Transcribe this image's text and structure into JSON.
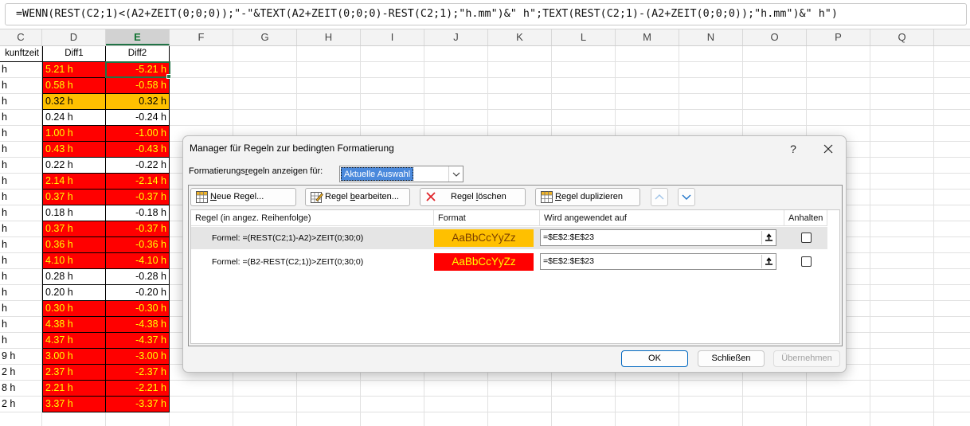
{
  "formula_bar": {
    "formula": "=WENN(REST(C2;1)<(A2+ZEIT(0;0;0));\"-\"&TEXT(A2+ZEIT(0;0;0)-REST(C2;1);\"h.mm\")&\" h\";TEXT(REST(C2;1)-(A2+ZEIT(0;0;0));\"h.mm\")&\" h\")"
  },
  "columns": [
    "C",
    "D",
    "E",
    "F",
    "G",
    "H",
    "I",
    "J",
    "K",
    "L",
    "M",
    "N",
    "O",
    "P",
    "Q"
  ],
  "table": {
    "headers": {
      "c": "kunftzeit",
      "d": "Diff1",
      "e": "Diff2"
    },
    "rows": [
      {
        "c": "h",
        "d": "5.21 h",
        "e": "-5.21 h",
        "d_fill": "red",
        "e_fill": "red"
      },
      {
        "c": "h",
        "d": "0.58 h",
        "e": "-0.58 h",
        "d_fill": "red",
        "e_fill": "red"
      },
      {
        "c": "h",
        "d": "0.32 h",
        "e": "0.32 h",
        "d_fill": "orange",
        "e_fill": "orange"
      },
      {
        "c": "h",
        "d": "0.24 h",
        "e": "-0.24 h",
        "d_fill": "none",
        "e_fill": "none"
      },
      {
        "c": "h",
        "d": "1.00 h",
        "e": "-1.00 h",
        "d_fill": "red",
        "e_fill": "red"
      },
      {
        "c": "h",
        "d": "0.43 h",
        "e": "-0.43 h",
        "d_fill": "red",
        "e_fill": "red"
      },
      {
        "c": "h",
        "d": "0.22 h",
        "e": "-0.22 h",
        "d_fill": "none",
        "e_fill": "none"
      },
      {
        "c": "h",
        "d": "2.14 h",
        "e": "-2.14 h",
        "d_fill": "red",
        "e_fill": "red"
      },
      {
        "c": "h",
        "d": "0.37 h",
        "e": "-0.37 h",
        "d_fill": "red",
        "e_fill": "red"
      },
      {
        "c": "h",
        "d": "0.18 h",
        "e": "-0.18 h",
        "d_fill": "none",
        "e_fill": "none"
      },
      {
        "c": "h",
        "d": "0.37 h",
        "e": "-0.37 h",
        "d_fill": "red",
        "e_fill": "red"
      },
      {
        "c": "h",
        "d": "0.36 h",
        "e": "-0.36 h",
        "d_fill": "red",
        "e_fill": "red"
      },
      {
        "c": "h",
        "d": "4.10 h",
        "e": "-4.10 h",
        "d_fill": "red",
        "e_fill": "red"
      },
      {
        "c": "h",
        "d": "0.28 h",
        "e": "-0.28 h",
        "d_fill": "none",
        "e_fill": "none"
      },
      {
        "c": "h",
        "d": "0.20 h",
        "e": "-0.20 h",
        "d_fill": "none",
        "e_fill": "none"
      },
      {
        "c": "h",
        "d": "0.30 h",
        "e": "-0.30 h",
        "d_fill": "red",
        "e_fill": "red"
      },
      {
        "c": "h",
        "d": "4.38 h",
        "e": "-4.38 h",
        "d_fill": "red",
        "e_fill": "red"
      },
      {
        "c": "h",
        "d": "4.37 h",
        "e": "-4.37 h",
        "d_fill": "red",
        "e_fill": "red"
      },
      {
        "c": "9 h",
        "d": "3.00 h",
        "e": "-3.00 h",
        "d_fill": "red",
        "e_fill": "red"
      },
      {
        "c": "2 h",
        "d": "2.37 h",
        "e": "-2.37 h",
        "d_fill": "red",
        "e_fill": "red"
      },
      {
        "c": "8 h",
        "d": "2.21 h",
        "e": "-2.21 h",
        "d_fill": "red",
        "e_fill": "red"
      },
      {
        "c": "2 h",
        "d": "3.37 h",
        "e": "-3.37 h",
        "d_fill": "red",
        "e_fill": "red"
      }
    ]
  },
  "colors": {
    "red_fill": "#ff0000",
    "orange_fill": "#ffc000",
    "red_fill_text": "#ffff00",
    "selection_green": "#217346",
    "dialog_primary_border": "#0067c0"
  },
  "dialog": {
    "title": "Manager für Regeln zur bedingten Formatierung",
    "help_label": "?",
    "show_rules_label_pre": "Formatierungs",
    "show_rules_label_u": "r",
    "show_rules_label_post": "egeln anzeigen für:",
    "show_rules_value": "Aktuelle Auswahl",
    "toolbar": {
      "new_pre": "",
      "new_u": "N",
      "new_post": "eue Regel...",
      "edit_pre": "Regel ",
      "edit_u": "b",
      "edit_post": "earbeiten...",
      "delete_pre": "Regel ",
      "delete_u": "l",
      "delete_post": "öschen",
      "duplicate_pre": "",
      "duplicate_u": "R",
      "duplicate_post": "egel duplizieren"
    },
    "list_headers": {
      "rule": "Regel (in angez. Reihenfolge)",
      "format": "Format",
      "applies_to": "Wird angewendet auf",
      "stop": "Anhalten"
    },
    "rules": [
      {
        "formula": "Formel: =(REST(C2;1)-A2)>ZEIT(0;30;0)",
        "preview": "AaBbCcYyZz",
        "preview_bg": "#ffc000",
        "preview_fg": "#7a3e00",
        "applies_to": "=$E$2:$E$23",
        "stop": false
      },
      {
        "formula": "Formel: =(B2-REST(C2;1))>ZEIT(0;30;0)",
        "preview": "AaBbCcYyZz",
        "preview_bg": "#ff0000",
        "preview_fg": "#ffff00",
        "applies_to": "=$E$2:$E$23",
        "stop": false
      }
    ],
    "buttons": {
      "ok": "OK",
      "close": "Schließen",
      "apply": "Übernehmen"
    }
  }
}
